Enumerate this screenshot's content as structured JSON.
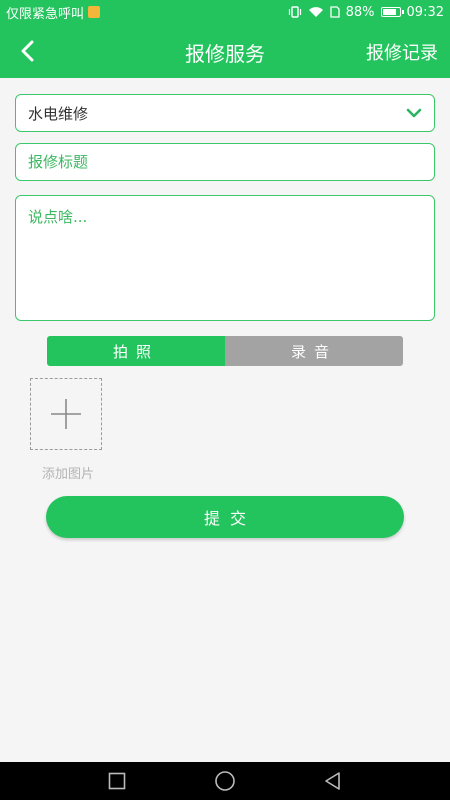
{
  "status_bar": {
    "carrier_text": "仅限紧急呼叫",
    "battery_percent": "88%",
    "battery_level": 0.88,
    "time": "09:32"
  },
  "app_bar": {
    "title": "报修服务",
    "action_label": "报修记录",
    "back_icon": "chevron-left-icon"
  },
  "form": {
    "category_value": "水电维修",
    "title_placeholder": "报修标题",
    "title_value": "",
    "description_placeholder": "说点啥...",
    "description_value": ""
  },
  "tabs": [
    {
      "label": "拍照",
      "active": true
    },
    {
      "label": "录音",
      "active": false
    }
  ],
  "attachments": {
    "add_label": "添加图片"
  },
  "submit_label": "提交",
  "colors": {
    "primary": "#23c45e",
    "inactive_tab": "#a3a3a3",
    "background": "#f5f5f5"
  }
}
